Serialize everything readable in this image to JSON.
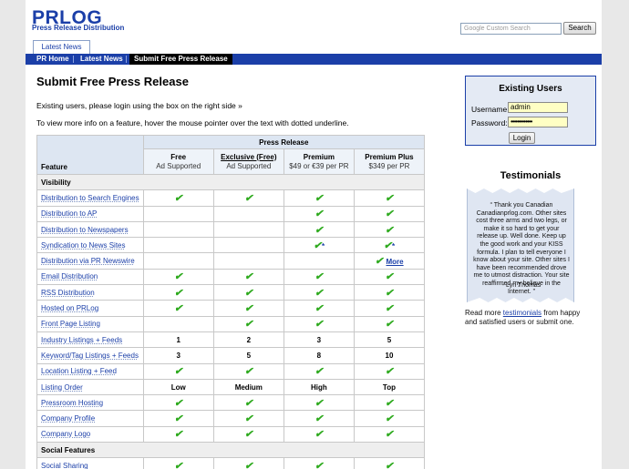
{
  "brand": {
    "logo": "PRLOG",
    "tagline": "Press Release Distribution"
  },
  "search": {
    "placeholder_google": "Google",
    "placeholder_text": "Custom Search",
    "button": "Search"
  },
  "tabs": {
    "latest_news": "Latest News"
  },
  "nav": {
    "items": [
      "PR Home",
      "Latest News",
      "Submit Free Press Release"
    ],
    "active_index": 2
  },
  "main": {
    "title": "Submit Free Press Release",
    "intro_login": "Existing users, please login using the box on the right side »",
    "intro_hover": "To view more info on a feature, hover the mouse pointer over the text with dotted underline."
  },
  "table": {
    "group_header": "Press Release",
    "feature_header": "Feature",
    "plans": [
      {
        "name": "Free",
        "sub": "Ad Supported"
      },
      {
        "name": "Exclusive (Free)",
        "sub": "Ad Supported"
      },
      {
        "name": "Premium",
        "sub": "$49 or €39 per PR"
      },
      {
        "name": "Premium Plus",
        "sub": "$349 per PR"
      }
    ],
    "more_link": "More",
    "rows": [
      {
        "section": "Visibility"
      },
      {
        "feature": "Distribution to Search Engines",
        "values": [
          "✔",
          "✔",
          "✔",
          "✔"
        ]
      },
      {
        "feature": "Distribution to AP",
        "values": [
          "",
          "",
          "✔",
          "✔"
        ]
      },
      {
        "feature": "Distribution to Newspapers",
        "values": [
          "",
          "",
          "✔",
          "✔"
        ]
      },
      {
        "feature": "Syndication to News Sites",
        "values": [
          "",
          "",
          "✔*",
          "✔*"
        ]
      },
      {
        "feature": "Distribution via PR Newswire",
        "values": [
          "",
          "",
          "",
          "✔ More"
        ]
      },
      {
        "feature": "Email Distribution",
        "values": [
          "✔",
          "✔",
          "✔",
          "✔"
        ]
      },
      {
        "feature": "RSS Distribution",
        "values": [
          "✔",
          "✔",
          "✔",
          "✔"
        ]
      },
      {
        "feature": "Hosted on PRLog",
        "values": [
          "✔",
          "✔",
          "✔",
          "✔"
        ]
      },
      {
        "feature": "Front Page Listing",
        "values": [
          "",
          "✔",
          "✔",
          "✔"
        ]
      },
      {
        "feature": "Industry Listings + Feeds",
        "values": [
          "1",
          "2",
          "3",
          "5"
        ]
      },
      {
        "feature": "Keyword/Tag Listings + Feeds",
        "values": [
          "3",
          "5",
          "8",
          "10"
        ]
      },
      {
        "feature": "Location Listing + Feed",
        "values": [
          "✔",
          "✔",
          "✔",
          "✔"
        ]
      },
      {
        "feature": "Listing Order",
        "values": [
          "Low",
          "Medium",
          "High",
          "Top"
        ]
      },
      {
        "feature": "Pressroom Hosting",
        "values": [
          "✔",
          "✔",
          "✔",
          "✔"
        ]
      },
      {
        "feature": "Company Profile",
        "values": [
          "✔",
          "✔",
          "✔",
          "✔"
        ]
      },
      {
        "feature": "Company Logo",
        "values": [
          "✔",
          "✔",
          "✔",
          "✔"
        ]
      },
      {
        "section": "Social Features"
      },
      {
        "feature": "Social Sharing",
        "values": [
          "✔",
          "✔",
          "✔",
          "✔"
        ]
      }
    ]
  },
  "login": {
    "title": "Existing Users",
    "username_label": "Username:",
    "username_value": "admin",
    "password_label": "Password:",
    "password_value": "•••••••••••••",
    "button": "Login"
  },
  "testimonials": {
    "title": "Testimonials",
    "quote": "“ Thank you Canadian Canadianprlog.com. Other sites cost three arms and two legs, or make it so hard to get your release up. Well done. Keep up the good work and your KISS formula. I plan to tell everyone I know about your site. Other sites I have been recommended drove me to utmost distraction. Your site reaffirmed my believe in the Internet. ”",
    "author": "- Lyn Thomas",
    "read_more_prefix": "Read more ",
    "read_more_link": "testimonials",
    "read_more_suffix": " from happy and satisfied users or submit one."
  },
  "colors": {
    "brand_blue": "#1b3fa8",
    "check_green": "#2eaa1e",
    "input_yellow": "#ffffc4"
  }
}
